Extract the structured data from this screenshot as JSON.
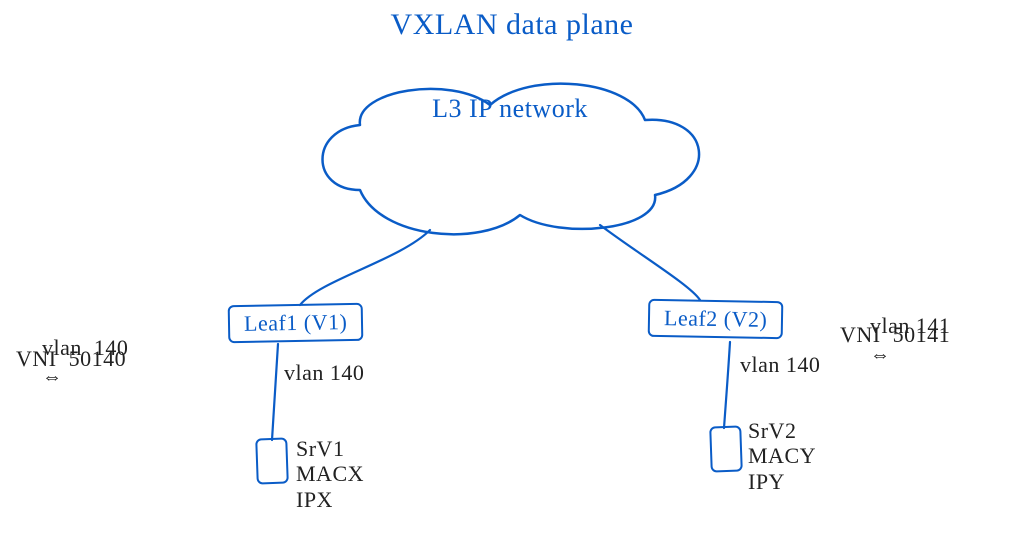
{
  "title": "VXLAN  data  plane",
  "cloud": {
    "label": "L3  IP network"
  },
  "leaf1": {
    "box_label": "Leaf1 (V1)",
    "mapping_line1": "vlan  140",
    "mapping_line2": "VNI  50140",
    "downlink_vlan": "vlan 140"
  },
  "leaf2": {
    "box_label": "Leaf2 (V2)",
    "mapping_line1": "vlan 141",
    "mapping_line2": "VNI  50141",
    "downlink_vlan": "vlan 140"
  },
  "srv1": {
    "name": "SrV1",
    "mac": "MACX",
    "ip": "IPX"
  },
  "srv2": {
    "name": "SrV2",
    "mac": "MACY",
    "ip": "IPY"
  },
  "glyphs": {
    "bidir": "⇔"
  },
  "colors": {
    "ink_blue": "#0a5cc7",
    "ink_black": "#222222"
  }
}
